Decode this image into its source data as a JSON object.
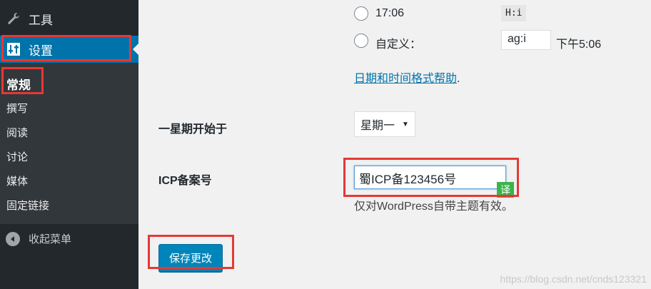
{
  "sidebar": {
    "tools": {
      "label": "工具",
      "icon": "wrench-icon"
    },
    "settings": {
      "label": "设置",
      "icon": "settings-sliders-icon"
    },
    "submenu": [
      {
        "label": "常规",
        "current": true
      },
      {
        "label": "撰写"
      },
      {
        "label": "阅读"
      },
      {
        "label": "讨论"
      },
      {
        "label": "媒体"
      },
      {
        "label": "固定链接"
      }
    ],
    "collapse": {
      "label": "收起菜单",
      "icon": "collapse-arrow-icon"
    }
  },
  "time_format": {
    "option_1": {
      "label": "17:06",
      "code": "H:i"
    },
    "custom": {
      "label": "自定义：",
      "value": "ag:i",
      "preview": "下午5:06"
    },
    "help_link": "日期和时间格式帮助",
    "help_suffix": "."
  },
  "week_start": {
    "label": "一星期开始于",
    "selected": "星期一"
  },
  "icp": {
    "label": "ICP备案号",
    "value": "蜀ICP备123456号",
    "badge": "译",
    "description": "仅对WordPress自带主题有效。"
  },
  "save_button": "保存更改",
  "watermark": "https://blog.csdn.net/cnds123321",
  "colors": {
    "sidebar": "#23282d",
    "active": "#0073aa",
    "highlight": "#e53935",
    "button": "#0085ba"
  }
}
